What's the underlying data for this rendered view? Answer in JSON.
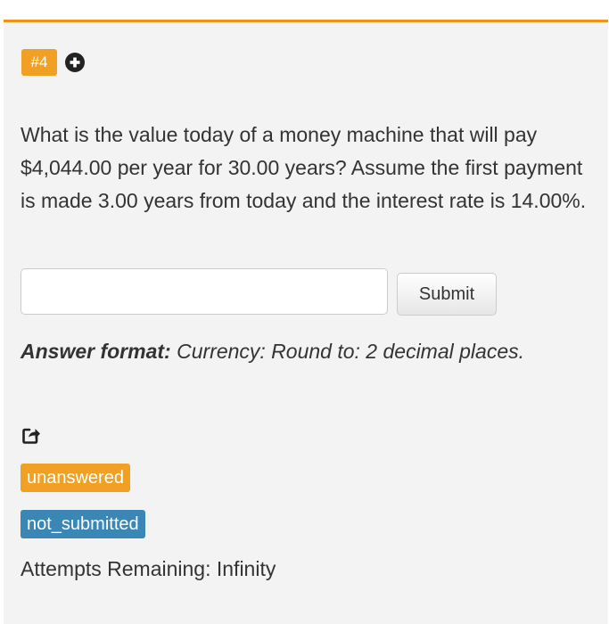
{
  "question_number": "#4",
  "icons": {
    "add": "plus-circle-icon",
    "share": "share-icon"
  },
  "question_text": "What is the value today of a money machine that will pay $4,044.00 per year for 30.00 years? Assume the first payment is made 3.00 years from today and the interest rate is 14.00%.",
  "answer_input": {
    "value": "",
    "placeholder": ""
  },
  "submit_label": "Submit",
  "answer_format": {
    "label": "Answer format:",
    "value": " Currency: Round to: 2 decimal places."
  },
  "statuses": {
    "answer_status": "unanswered",
    "submission_status": "not_submitted"
  },
  "attempts_text": "Attempts Remaining: Infinity",
  "colors": {
    "accent": "#ef9318",
    "badge_orange": "#f0a022",
    "badge_blue": "#3a86b5",
    "panel_bg": "#f3f3f3"
  }
}
